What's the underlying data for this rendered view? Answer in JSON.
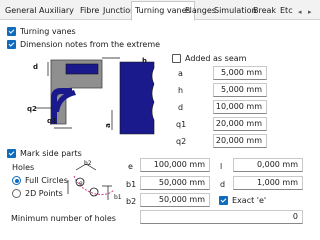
{
  "tabs": [
    {
      "label": "General"
    },
    {
      "label": "Auxiliary"
    },
    {
      "label": "Fibre"
    },
    {
      "label": "Junction"
    },
    {
      "label": "Turning vanes"
    },
    {
      "label": "Flanges"
    },
    {
      "label": "Simulation"
    },
    {
      "label": "Break"
    },
    {
      "label": "Etc"
    }
  ],
  "tab_scroll": {
    "left": "◂",
    "right": "▸"
  },
  "checks": {
    "turning_vanes": {
      "label": "Turning vanes",
      "checked": true
    },
    "dimension_notes": {
      "label": "Dimension notes from the extreme",
      "checked": true
    },
    "added_as_seam": {
      "label": "Added as seam",
      "checked": false
    },
    "mark_side_parts": {
      "label": "Mark side parts",
      "checked": true
    },
    "exact_e": {
      "label": "Exact 'e'",
      "checked": true
    }
  },
  "dims": [
    {
      "name": "a",
      "value": "5,000 mm"
    },
    {
      "name": "h",
      "value": "5,000 mm"
    },
    {
      "name": "d",
      "value": "10,000 mm"
    },
    {
      "name": "q1",
      "value": "20,000 mm"
    },
    {
      "name": "q2",
      "value": "20,000 mm"
    }
  ],
  "diagram_labels": {
    "d": "d",
    "h": "h",
    "q1": "q1",
    "q2": "q2",
    "a": "a"
  },
  "holes": {
    "title": "Holes",
    "options": [
      {
        "label": "Full Circles",
        "selected": true
      },
      {
        "label": "2D Points",
        "selected": false
      }
    ],
    "diagram_labels": {
      "b2": "b2",
      "e": "e",
      "b1": "b1"
    }
  },
  "hole_fields": {
    "e": {
      "label": "e",
      "value": "100,000 mm"
    },
    "b1": {
      "label": "b1",
      "value": "50,000 mm"
    },
    "b2": {
      "label": "b2",
      "value": "50,000 mm"
    },
    "l": {
      "label": "l",
      "value": "0,000 mm"
    },
    "d": {
      "label": "d",
      "value": "1,000 mm"
    }
  },
  "min_holes": {
    "label": "Minimum number of holes",
    "value": "0"
  },
  "colors": {
    "accent": "#0f6cbd",
    "diagram_fill": "#1a1a8c",
    "diagram_gray": "#9a9a9a",
    "dim_pink": "#d0408a"
  }
}
